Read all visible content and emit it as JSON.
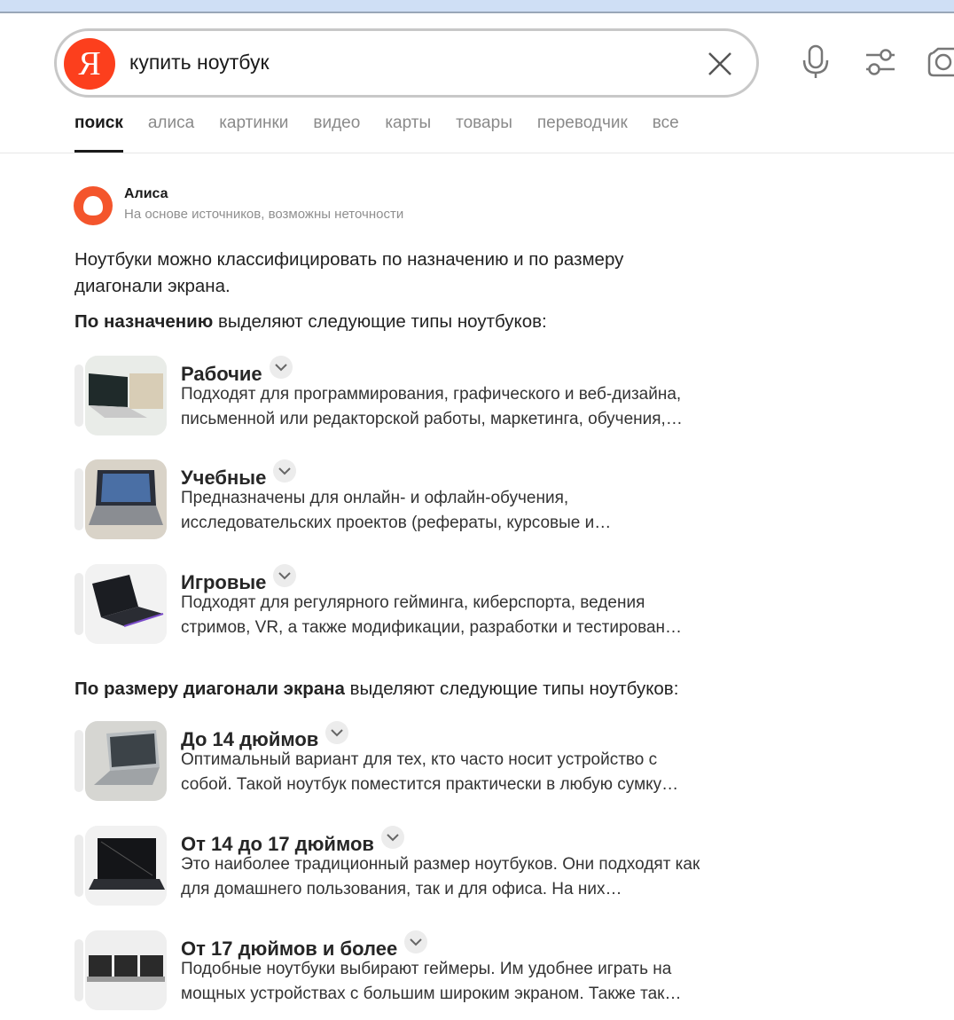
{
  "search": {
    "logo_letter": "Я",
    "query": "купить ноутбук"
  },
  "tabs": [
    {
      "label": "поиск",
      "active": true
    },
    {
      "label": "алиса"
    },
    {
      "label": "картинки"
    },
    {
      "label": "видео"
    },
    {
      "label": "карты"
    },
    {
      "label": "товары"
    },
    {
      "label": "переводчик"
    },
    {
      "label": "все"
    }
  ],
  "alice": {
    "name": "Алиса",
    "subtitle": "На основе источников, возможны неточности"
  },
  "answer": {
    "intro": "Ноутбуки можно классифицировать по назначению и по размеру диагонали экрана.",
    "purpose_heading_bold": "По назначению",
    "purpose_heading_rest": " выделяют следующие типы ноутбуков:",
    "purpose_items": [
      {
        "title": "Рабочие",
        "text": "Подходят для программирования, графического и веб-дизайна, письменной или редакторской работы, маркетинга, обучения,…"
      },
      {
        "title": "Учебные",
        "text": "Предназначены для онлайн- и офлайн-обучения, исследовательских проектов (рефераты, курсовые и…"
      },
      {
        "title": "Игровые",
        "text": "Подходят для регулярного гейминга, киберспорта, ведения стримов, VR, а также модификации, разработки и тестирован…"
      }
    ],
    "size_heading_bold": "По размеру диагонали экрана",
    "size_heading_rest": " выделяют следующие типы ноутбуков:",
    "size_items": [
      {
        "title": "До 14 дюймов",
        "text": "Оптимальный вариант для тех, кто часто носит устройство с собой. Такой ноутбук поместится практически в любую сумку…"
      },
      {
        "title": "От 14 до 17 дюймов",
        "text": "Это наиболее традиционный размер ноутбуков. Они подходят как для домашнего пользования, так и для офиса. На них…"
      },
      {
        "title": "От 17 дюймов и более",
        "text": "Подобные ноутбуки выбирают геймеры. Им удобнее играть на мощных устройствах с большим широким экраном. Также так…"
      }
    ]
  },
  "colors": {
    "yandex_red": "#fc3f1d",
    "alice_orange": "#f4552c"
  }
}
